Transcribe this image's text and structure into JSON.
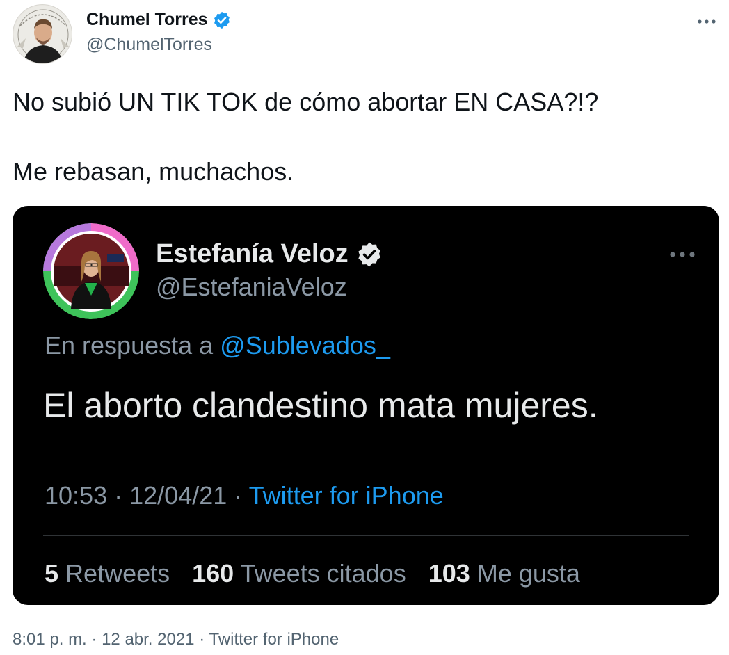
{
  "author": {
    "display_name": "Chumel Torres",
    "handle": "@ChumelTorres",
    "verified": true,
    "avatar_icon": "profile-photo"
  },
  "tweet": {
    "line1": "No subió UN TIK TOK de cómo abortar EN CASA?!?",
    "line2": "Me rebasan, muchachos."
  },
  "quote": {
    "display_name": "Estefanía Veloz",
    "handle": "@EstefaniaVeloz",
    "verified": true,
    "reply_prefix": "En respuesta a",
    "reply_mention": "@Sublevados_",
    "text": "El aborto clandestino mata mujeres.",
    "time": "10:53",
    "date": "12/04/21",
    "source": "Twitter for iPhone",
    "stats": {
      "retweets_count": "5",
      "retweets_label": "Retweets",
      "quotes_count": "160",
      "quotes_label": "Tweets citados",
      "likes_count": "103",
      "likes_label": "Me gusta"
    }
  },
  "footer": {
    "time": "8:01 p. m.",
    "date": "12 abr. 2021",
    "source": "Twitter for iPhone"
  },
  "colors": {
    "verified_blue": "#1d9bf0",
    "link_blue": "#1d9bf0",
    "quote_bg": "#000000",
    "secondary_text": "#536471"
  }
}
